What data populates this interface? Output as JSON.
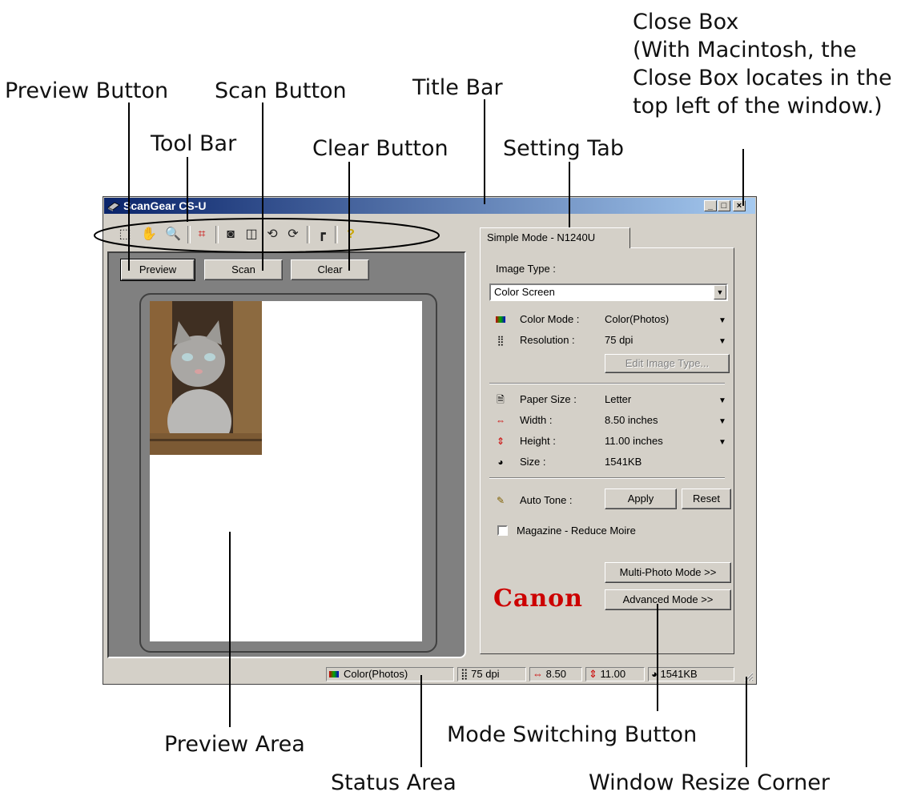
{
  "window": {
    "title": "ScanGear CS-U",
    "controls": {
      "minimize": "_",
      "maximize": "□",
      "close": "×"
    }
  },
  "toolbar": {
    "tools": [
      "crop-tool-icon",
      "hand-tool-icon",
      "zoom-tool-icon",
      "auto-crop-icon",
      "invert-icon",
      "mirror-icon",
      "rotate-left-icon",
      "rotate-right-icon",
      "ruler-icon",
      "help-icon"
    ]
  },
  "buttons": {
    "preview": "Preview",
    "scan": "Scan",
    "clear": "Clear"
  },
  "settings": {
    "tab_label": "Simple Mode - N1240U",
    "image_type_label": "Image Type :",
    "image_type_value": "Color Screen",
    "color_mode_label": "Color Mode :",
    "color_mode_value": "Color(Photos)",
    "resolution_label": "Resolution :",
    "resolution_value": "75 dpi",
    "edit_image_type": "Edit Image Type...",
    "paper_size_label": "Paper Size :",
    "paper_size_value": "Letter",
    "width_label": "Width :",
    "width_value": "8.50 inches",
    "height_label": "Height :",
    "height_value": "11.00 inches",
    "size_label": "Size :",
    "size_value": "1541KB",
    "auto_tone_label": "Auto Tone :",
    "apply": "Apply",
    "reset": "Reset",
    "magazine_label": "Magazine - Reduce Moire",
    "magazine_checked": false,
    "multi_photo": "Multi-Photo Mode >>",
    "advanced": "Advanced Mode >>",
    "brand": "Canon"
  },
  "status": {
    "color_mode": "Color(Photos)",
    "resolution": "75 dpi",
    "width": "8.50",
    "height": "11.00",
    "size": "1541KB"
  },
  "callouts": {
    "close_box_1": "Close Box",
    "close_box_2": "(With Macintosh, the",
    "close_box_3": "Close Box locates in the",
    "close_box_4": "top left of the window.)",
    "preview_button": "Preview Button",
    "scan_button": "Scan Button",
    "title_bar": "Title Bar",
    "tool_bar": "Tool Bar",
    "clear_button": "Clear Button",
    "setting_tab": "Setting Tab",
    "preview_area": "Preview Area",
    "mode_switching": "Mode Switching Button",
    "status_area": "Status Area",
    "resize_corner": "Window Resize Corner"
  },
  "colors": {
    "brand_red": "#cc0000",
    "title_start": "#0a246a",
    "title_end": "#a6caf0",
    "face": "#d4d0c8"
  }
}
